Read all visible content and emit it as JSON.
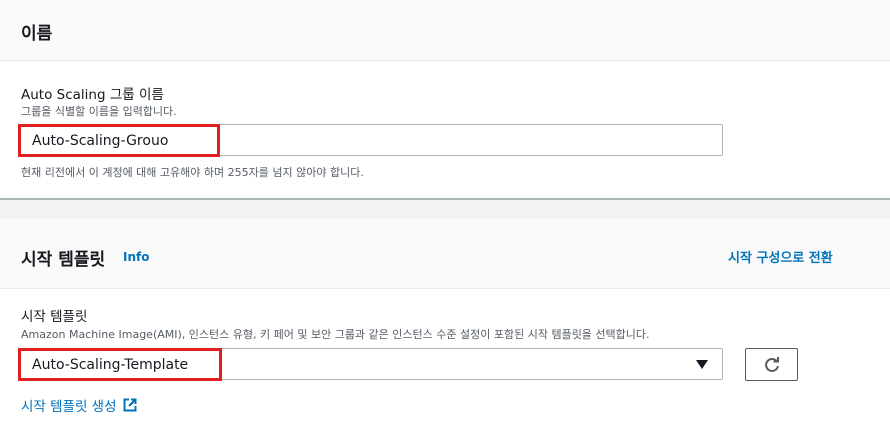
{
  "name_section": {
    "title": "이름",
    "field_label": "Auto Scaling 그룹 이름",
    "field_description": "그룹을 식별할 이름을 입력합니다.",
    "field_value": "Auto-Scaling-Grouo",
    "constraint": "현재 리전에서 이 계정에 대해 고유해야 하며 255자를 넘지 않아야 합니다."
  },
  "template_section": {
    "title": "시작 템플릿",
    "info_link": "Info",
    "switch_link": "시작 구성으로 전환",
    "field_label": "시작 템플릿",
    "field_description": "Amazon Machine Image(AMI), 인스턴스 유형, 키 페어 및 보안 그룹과 같은 인스턴스 수준 설정이 포함된 시작 템플릿을 선택합니다.",
    "selected_value": "Auto-Scaling-Template",
    "create_link": "시작 템플릿 생성"
  },
  "colors": {
    "highlight": "#e02020",
    "link": "#0073bb"
  },
  "icons": [
    "chevron-down-icon",
    "refresh-icon",
    "external-link-icon"
  ]
}
